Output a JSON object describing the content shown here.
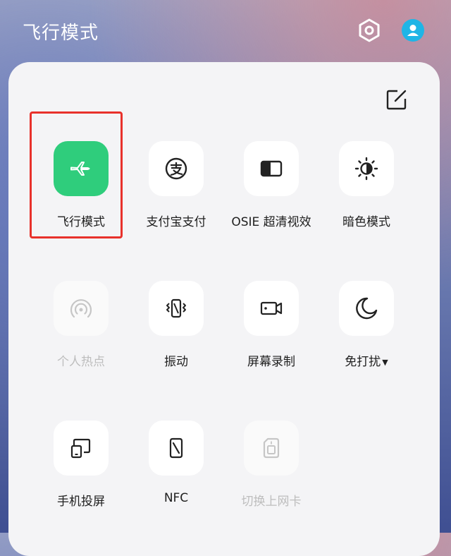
{
  "header": {
    "title": "飞行模式",
    "settings_icon": "gear-icon",
    "account_icon": "user-avatar-icon"
  },
  "panel": {
    "edit_icon": "edit-icon",
    "tiles": [
      {
        "label": "飞行模式",
        "icon": "airplane-icon",
        "state": "active"
      },
      {
        "label": "支付宝支付",
        "icon": "alipay-icon",
        "state": "off"
      },
      {
        "label": "OSIE 超清视效",
        "icon": "display-enhance-icon",
        "state": "off"
      },
      {
        "label": "暗色模式",
        "icon": "dark-mode-icon",
        "state": "off"
      },
      {
        "label": "个人热点",
        "icon": "hotspot-icon",
        "state": "disabled"
      },
      {
        "label": "振动",
        "icon": "vibrate-icon",
        "state": "off"
      },
      {
        "label": "屏幕录制",
        "icon": "screen-record-icon",
        "state": "off"
      },
      {
        "label": "免打扰",
        "icon": "moon-icon",
        "state": "off",
        "has_dropdown": true
      },
      {
        "label": "手机投屏",
        "icon": "screen-cast-icon",
        "state": "off"
      },
      {
        "label": "NFC",
        "icon": "nfc-icon",
        "state": "off"
      },
      {
        "label": "切换上网卡",
        "icon": "sim-card-icon",
        "state": "disabled"
      }
    ]
  },
  "colors": {
    "active_tile": "#2fcd7c",
    "highlight_box": "#e8312b",
    "disabled_text": "#bdbdbd"
  }
}
